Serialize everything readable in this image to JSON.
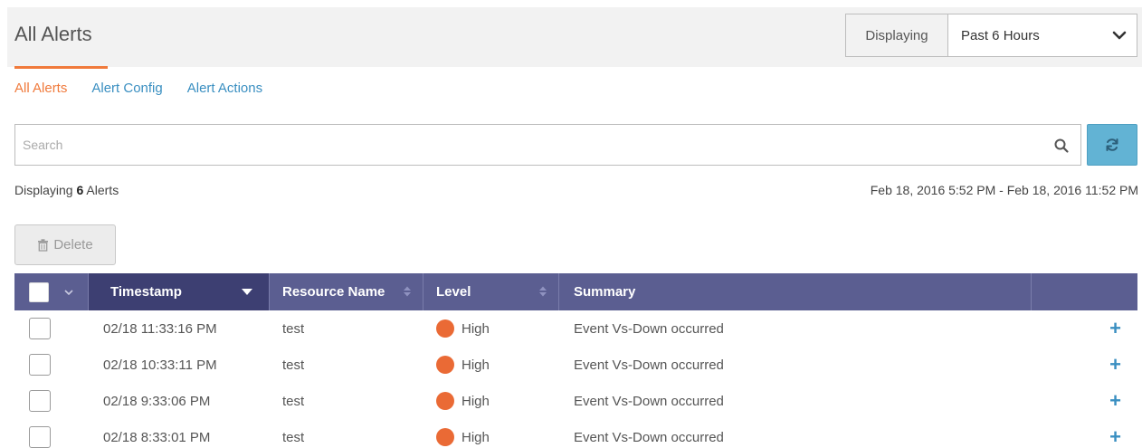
{
  "header": {
    "title": "All Alerts",
    "range_label": "Displaying",
    "range_value": "Past 6 Hours"
  },
  "tabs": [
    {
      "label": "All Alerts",
      "active": true
    },
    {
      "label": "Alert Config",
      "active": false
    },
    {
      "label": "Alert Actions",
      "active": false
    }
  ],
  "search": {
    "placeholder": "Search",
    "value": ""
  },
  "summary": {
    "prefix": "Displaying",
    "count": "6",
    "suffix": "Alerts",
    "date_range": "Feb 18, 2016 5:52 PM - Feb 18, 2016 11:52 PM"
  },
  "toolbar": {
    "delete_label": "Delete"
  },
  "table": {
    "columns": [
      "Timestamp",
      "Resource Name",
      "Level",
      "Summary"
    ],
    "rows": [
      {
        "timestamp": "02/18 11:33:16 PM",
        "resource": "test",
        "level": "High",
        "summary": "Event Vs-Down occurred"
      },
      {
        "timestamp": "02/18 10:33:11 PM",
        "resource": "test",
        "level": "High",
        "summary": "Event Vs-Down occurred"
      },
      {
        "timestamp": "02/18 9:33:06 PM",
        "resource": "test",
        "level": "High",
        "summary": "Event Vs-Down occurred"
      },
      {
        "timestamp": "02/18 8:33:01 PM",
        "resource": "test",
        "level": "High",
        "summary": "Event Vs-Down occurred"
      }
    ]
  },
  "colors": {
    "accent": "#f07a3c",
    "link": "#3a8fc1",
    "table_header": "#5b5e91",
    "table_header_sorted": "#3d3f72",
    "level_high": "#ea6a35",
    "refresh_button": "#62b3d4"
  },
  "icons": {
    "range_chevron": "chevron-down-icon",
    "search": "search-icon",
    "refresh": "refresh-icon",
    "delete": "trash-icon",
    "expand_row": "plus-icon"
  }
}
